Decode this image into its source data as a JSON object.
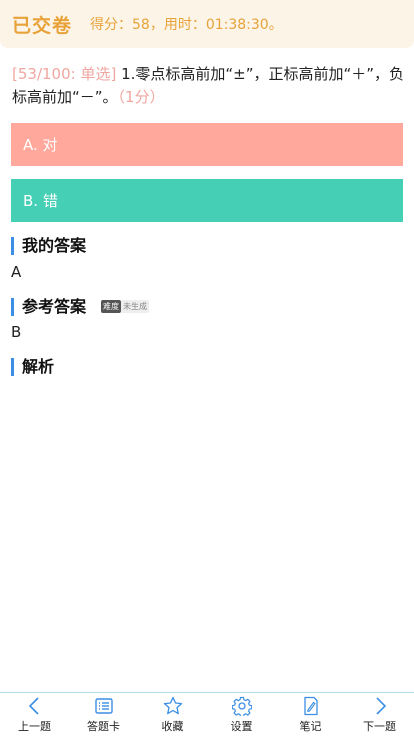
{
  "header": {
    "title": "已交卷",
    "score_text": "得分：58，用时：01:38:30。"
  },
  "question": {
    "tag": "[53/100: 单选]",
    "text": " 1.零点标高前加“±”，正标高前加“＋”，负标高前加“－”。",
    "points": "（1分）"
  },
  "options": [
    {
      "label": "A. 对",
      "color": "#ffa89b"
    },
    {
      "label": "B. 错",
      "color": "#45cfb5"
    }
  ],
  "my_answer": {
    "title": "我的答案",
    "value": "A"
  },
  "reference_answer": {
    "title": "参考答案",
    "difficulty_label": "难度",
    "difficulty_value": "未生成",
    "value": "B"
  },
  "analysis": {
    "title": "解析"
  },
  "bottom_nav": [
    {
      "label": "上一题",
      "icon": "chevron-left-icon"
    },
    {
      "label": "答题卡",
      "icon": "list-icon"
    },
    {
      "label": "收藏",
      "icon": "star-icon"
    },
    {
      "label": "设置",
      "icon": "gear-icon"
    },
    {
      "label": "笔记",
      "icon": "note-icon"
    },
    {
      "label": "下一题",
      "icon": "chevron-right-icon"
    }
  ],
  "colors": {
    "accent": "#e7a33a",
    "section_bar": "#3b8ee5",
    "icon": "#3b8ee5"
  }
}
